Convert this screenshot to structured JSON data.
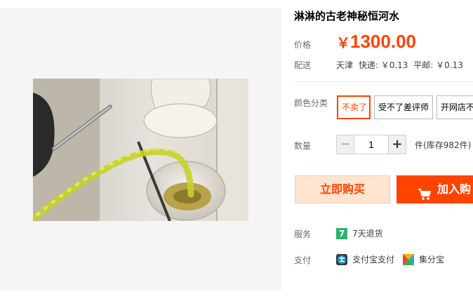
{
  "product": {
    "title": "淋淋的古老神秘恒河水",
    "image_alt": "product photo"
  },
  "price": {
    "label": "价格",
    "currency": "￥",
    "amount": "1300.00",
    "color": "#ff4400"
  },
  "shipping": {
    "label": "配送",
    "origin": "天津",
    "express": "快递: ￥0.13",
    "surface": "平邮: ￥0.13"
  },
  "options": {
    "label": "颜色分类",
    "items": [
      "不卖了",
      "受不了差评师",
      "开网店不"
    ],
    "selected_index": 0
  },
  "quantity": {
    "label": "数量",
    "minus": "−",
    "value": "1",
    "plus": "+",
    "stock": "件(库存982件)"
  },
  "actions": {
    "buy_now": "立即购买",
    "add_to_cart": "加入购"
  },
  "service": {
    "label": "服务",
    "badge": "7",
    "text": "7天退货"
  },
  "payment": {
    "label": "支付",
    "methods": [
      "支付宝支付",
      "集分宝"
    ]
  }
}
